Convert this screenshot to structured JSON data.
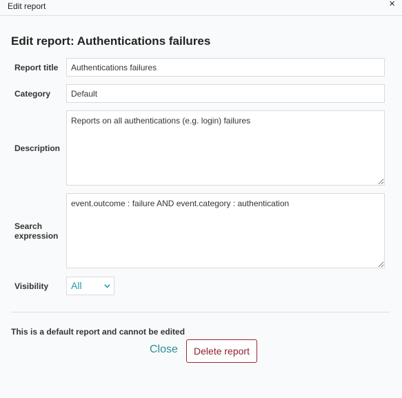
{
  "window": {
    "title": "Edit report",
    "close_glyph": "×"
  },
  "heading": "Edit report: Authentications failures",
  "form": {
    "report_title_label": "Report title",
    "report_title_value": "Authentications failures",
    "category_label": "Category",
    "category_value": "Default",
    "description_label": "Description",
    "description_value": "Reports on all authentications (e.g. login) failures",
    "search_label_line1": "Search",
    "search_label_line2": "expression",
    "search_value": "event.outcome : failure AND event.category : authentication",
    "visibility_label": "Visibility",
    "visibility_value": "All"
  },
  "footer": {
    "note": "This is a default report and cannot be edited",
    "close_label": "Close",
    "delete_label": "Delete report"
  },
  "colors": {
    "accent": "#1e9aa8",
    "danger": "#8f1f2e",
    "border": "#d7dade"
  }
}
